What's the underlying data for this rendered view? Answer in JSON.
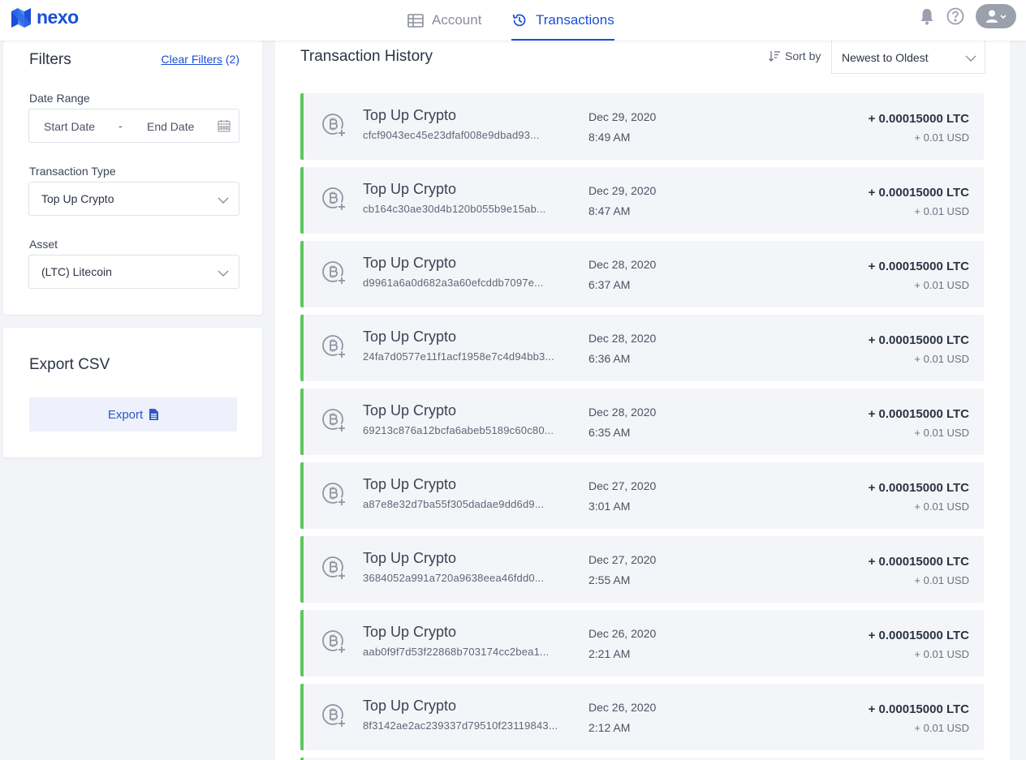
{
  "brand": {
    "name": "nexo",
    "color": "#1a4fd6"
  },
  "nav": {
    "account_label": "Account",
    "transactions_label": "Transactions",
    "active_tab": "Transactions"
  },
  "filters": {
    "title": "Filters",
    "clear_label": "Clear Filters",
    "clear_count": "(2)",
    "date_range_label": "Date Range",
    "start_date_placeholder": "Start Date",
    "date_separator": "-",
    "end_date_placeholder": "End Date",
    "transaction_type_label": "Transaction Type",
    "transaction_type_value": "Top Up Crypto",
    "asset_label": "Asset",
    "asset_value": "(LTC) Litecoin"
  },
  "export": {
    "title": "Export CSV",
    "button_label": "Export"
  },
  "history": {
    "title": "Transaction History",
    "sort_label": "Sort by",
    "sort_value": "Newest to Oldest"
  },
  "transactions": [
    {
      "type": "Top Up Crypto",
      "hash": "cfcf9043ec45e23dfaf008e9dbad93...",
      "date": "Dec 29, 2020",
      "time": "8:49 AM",
      "amount": "+ 0.00015000 LTC",
      "usd": "+ 0.01 USD"
    },
    {
      "type": "Top Up Crypto",
      "hash": "cb164c30ae30d4b120b055b9e15ab...",
      "date": "Dec 29, 2020",
      "time": "8:47 AM",
      "amount": "+ 0.00015000 LTC",
      "usd": "+ 0.01 USD"
    },
    {
      "type": "Top Up Crypto",
      "hash": "d9961a6a0d682a3a60efcddb7097e...",
      "date": "Dec 28, 2020",
      "time": "6:37 AM",
      "amount": "+ 0.00015000 LTC",
      "usd": "+ 0.01 USD"
    },
    {
      "type": "Top Up Crypto",
      "hash": "24fa7d0577e11f1acf1958e7c4d94bb3...",
      "date": "Dec 28, 2020",
      "time": "6:36 AM",
      "amount": "+ 0.00015000 LTC",
      "usd": "+ 0.01 USD"
    },
    {
      "type": "Top Up Crypto",
      "hash": "69213c876a12bcfa6abeb5189c60c80...",
      "date": "Dec 28, 2020",
      "time": "6:35 AM",
      "amount": "+ 0.00015000 LTC",
      "usd": "+ 0.01 USD"
    },
    {
      "type": "Top Up Crypto",
      "hash": "a87e8e32d7ba55f305dadae9dd6d9...",
      "date": "Dec 27, 2020",
      "time": "3:01 AM",
      "amount": "+ 0.00015000 LTC",
      "usd": "+ 0.01 USD"
    },
    {
      "type": "Top Up Crypto",
      "hash": "3684052a991a720a9638eea46fdd0...",
      "date": "Dec 27, 2020",
      "time": "2:55 AM",
      "amount": "+ 0.00015000 LTC",
      "usd": "+ 0.01 USD"
    },
    {
      "type": "Top Up Crypto",
      "hash": "aab0f9f7d53f22868b703174cc2bea1...",
      "date": "Dec 26, 2020",
      "time": "2:21 AM",
      "amount": "+ 0.00015000 LTC",
      "usd": "+ 0.01 USD"
    },
    {
      "type": "Top Up Crypto",
      "hash": "8f3142ae2ac239337d79510f23119843...",
      "date": "Dec 26, 2020",
      "time": "2:12 AM",
      "amount": "+ 0.00015000 LTC",
      "usd": "+ 0.01 USD"
    }
  ],
  "colors": {
    "accent": "#1a4fd6",
    "credit_bar": "#5cc85f",
    "row_bg": "#f4f5f8"
  },
  "icons": {
    "logo": "nexo-logo-icon",
    "account": "table-icon",
    "transactions": "history-icon",
    "notifications": "bell-icon",
    "help": "question-circle-icon",
    "user": "user-icon",
    "calendar": "calendar-icon",
    "dropdown": "chevron-down-icon",
    "sort": "sort-icon",
    "export": "file-icon",
    "transaction": "bitcoin-plus-icon"
  }
}
